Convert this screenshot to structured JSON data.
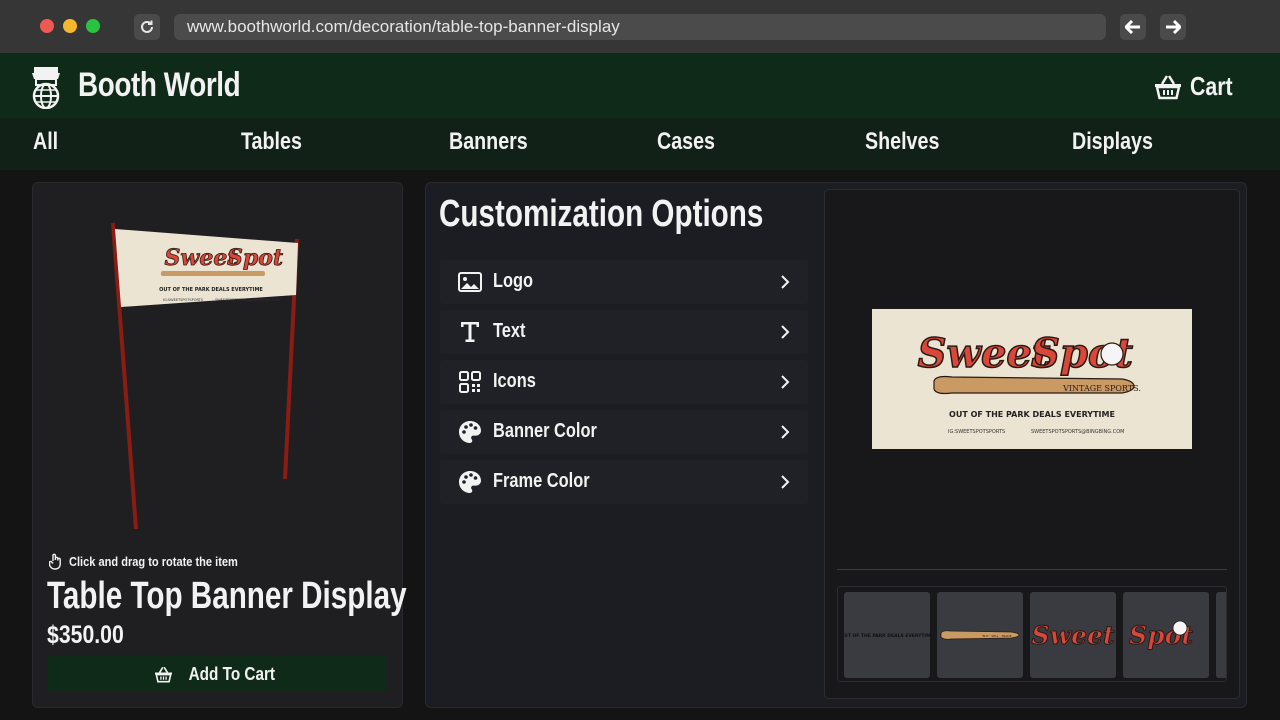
{
  "browser": {
    "url": "www.boothworld.com/decoration/table-top-banner-display"
  },
  "header": {
    "brand": "Booth World",
    "cart_label": "Cart"
  },
  "categories": [
    "All",
    "Tables",
    "Banners",
    "Cases",
    "Shelves",
    "Displays"
  ],
  "product": {
    "rotate_hint": "Click and drag to rotate the item",
    "title": "Table Top Banner Display",
    "price": "$350.00",
    "add_to_cart": "Add To Cart"
  },
  "customization": {
    "title": "Customization Options",
    "options": [
      {
        "label": "Logo",
        "icon": "image-icon"
      },
      {
        "label": "Text",
        "icon": "text-icon"
      },
      {
        "label": "Icons",
        "icon": "grid-icon"
      },
      {
        "label": "Banner Color",
        "icon": "palette-icon"
      },
      {
        "label": "Frame Color",
        "icon": "palette-icon"
      }
    ]
  },
  "banner_art": {
    "brand_word_1": "Sweet",
    "brand_word_2": "Spot",
    "subtitle": "VINTAGE SPORTS.",
    "tagline": "OUT OF THE PARK DEALS EVERYTIME",
    "instagram": "IG:SWEETSPOTSPORTS",
    "email": "SWEETSPOTSPORTS@BINGBING.COM",
    "bat_text": "BUY · SELL · TRADE"
  },
  "colors": {
    "header_green": "#0f2a18",
    "banner_cream": "#ece4d2",
    "logo_red": "#d9473a",
    "frame_red": "#8a1c14"
  }
}
